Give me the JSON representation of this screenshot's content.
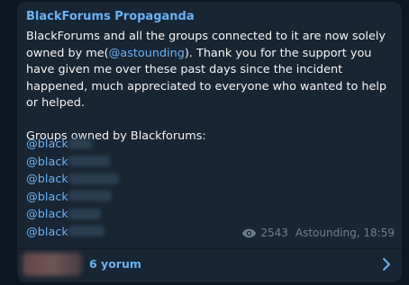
{
  "message": {
    "channel_name": "BlackForums Propaganda",
    "text_part1": "BlackForums and all the groups connected to it are now solely owned by me(",
    "mention": "@astounding",
    "text_part2": "). Thank you for the support you have given me over these past days since the incident happened, much appreciated to everyone who wanted to help or helped.",
    "groups_heading": "Groups owned by Blackforums:",
    "handles": [
      {
        "prefix": "@black"
      },
      {
        "prefix": "@black"
      },
      {
        "prefix": "@black"
      },
      {
        "prefix": "@black"
      },
      {
        "prefix": "@black"
      },
      {
        "prefix": "@black"
      }
    ],
    "views": "2543",
    "author_time": "Astounding, 18:59"
  },
  "comments": {
    "label": "6 yorum",
    "chevron_icon": "chevron-right-icon"
  },
  "colors": {
    "background": "#0e1621",
    "bubble": "#182533",
    "accent": "#6ab3f3",
    "text": "#f5f5f5",
    "meta": "#6c7f91"
  }
}
